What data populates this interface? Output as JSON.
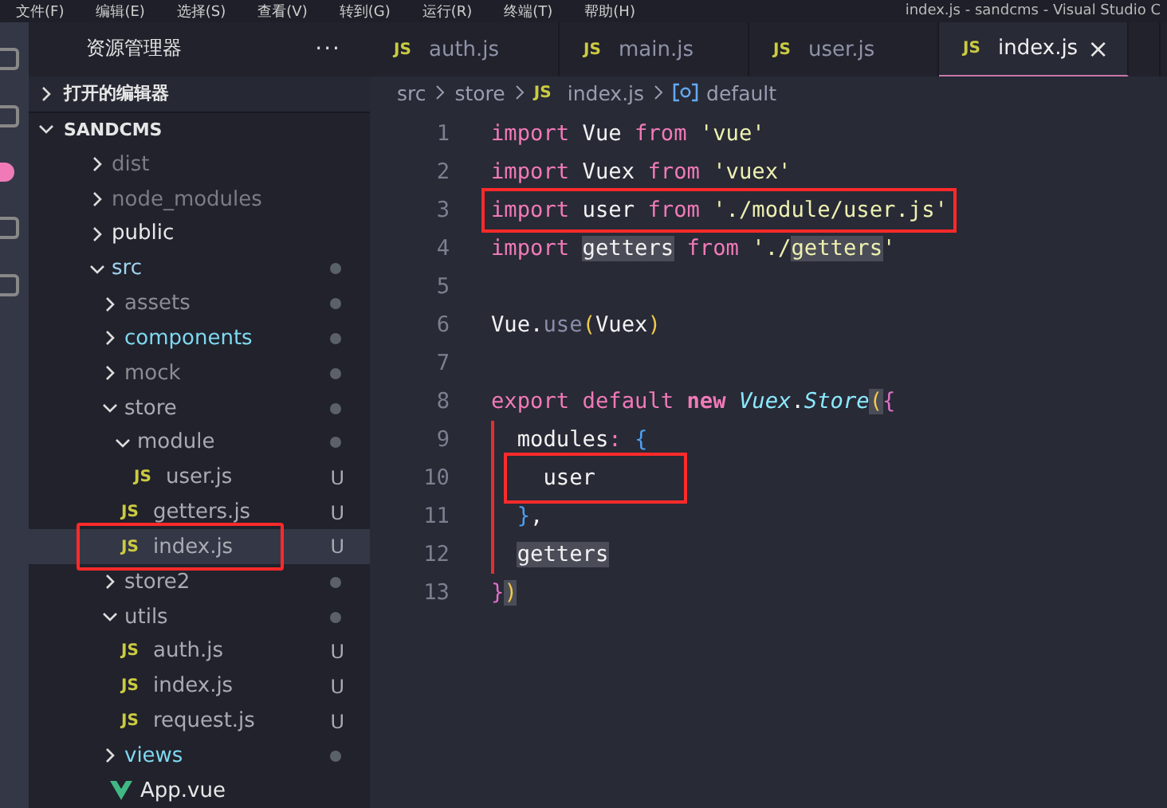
{
  "menu_bar": {
    "items": [
      "文件(F)",
      "编辑(E)",
      "选择(S)",
      "查看(V)",
      "转到(G)",
      "运行(R)",
      "终端(T)",
      "帮助(H)"
    ],
    "title": "index.js - sandcms - Visual Studio C"
  },
  "sidebar": {
    "title": "资源管理器",
    "more": "···",
    "sections": [
      {
        "label": "打开的编辑器",
        "expanded": false
      },
      {
        "label": "SANDCMS",
        "expanded": true
      }
    ],
    "tree": [
      {
        "name": "dist",
        "kind": "folder",
        "expanded": false,
        "color": "#7a7d85",
        "dot": false,
        "selected": false
      },
      {
        "name": "node_modules",
        "kind": "folder",
        "expanded": false,
        "color": "#7a7d85",
        "dot": false,
        "selected": false
      },
      {
        "name": "public",
        "kind": "folder",
        "expanded": false,
        "color": "#e8e8e8",
        "dot": false,
        "selected": false
      },
      {
        "name": "src",
        "kind": "folder",
        "expanded": true,
        "color": "#9fd3f0",
        "dot": true,
        "selected": false,
        "children": [
          {
            "name": "assets",
            "kind": "folder",
            "expanded": false,
            "color": "#8a8d94",
            "dot": true,
            "selected": false
          },
          {
            "name": "components",
            "kind": "folder",
            "expanded": false,
            "color": "#7fd8f0",
            "dot": true,
            "selected": false
          },
          {
            "name": "mock",
            "kind": "folder",
            "expanded": false,
            "color": "#8a8d94",
            "dot": true,
            "selected": false
          },
          {
            "name": "store",
            "kind": "folder",
            "expanded": true,
            "color": "#a9abb2",
            "dot": true,
            "selected": false,
            "children": [
              {
                "name": "module",
                "kind": "folder",
                "expanded": true,
                "color": "#a9abb2",
                "dot": true,
                "selected": false,
                "children": [
                  {
                    "name": "user.js",
                    "kind": "js",
                    "icon": "JS",
                    "badge": "U",
                    "color": "#a9abb2",
                    "selected": false
                  }
                ]
              },
              {
                "name": "getters.js",
                "kind": "js",
                "icon": "JS",
                "badge": "U",
                "color": "#a9abb2",
                "selected": false
              },
              {
                "name": "index.js",
                "kind": "js",
                "icon": "JS",
                "badge": "U",
                "color": "#a9abb2",
                "selected": true,
                "boxed": true
              }
            ]
          },
          {
            "name": "store2",
            "kind": "folder",
            "expanded": false,
            "color": "#a9abb2",
            "dot": true,
            "selected": false
          },
          {
            "name": "utils",
            "kind": "folder",
            "expanded": true,
            "color": "#a9abb2",
            "dot": true,
            "selected": false,
            "children": [
              {
                "name": "auth.js",
                "kind": "js",
                "icon": "JS",
                "badge": "U",
                "color": "#a9abb2",
                "selected": false
              },
              {
                "name": "index.js",
                "kind": "js",
                "icon": "JS",
                "badge": "U",
                "color": "#a9abb2",
                "selected": false
              },
              {
                "name": "request.js",
                "kind": "js",
                "icon": "JS",
                "badge": "U",
                "color": "#a9abb2",
                "selected": false
              }
            ]
          },
          {
            "name": "views",
            "kind": "folder",
            "expanded": false,
            "color": "#7fd8f0",
            "dot": true,
            "selected": false
          },
          {
            "name": "App.vue",
            "kind": "vue",
            "color": "#e8e8e8",
            "selected": false
          }
        ]
      }
    ]
  },
  "tabs": [
    {
      "icon": "JS",
      "label": "auth.js",
      "selected": false
    },
    {
      "icon": "JS",
      "label": "main.js",
      "selected": false
    },
    {
      "icon": "JS",
      "label": "user.js",
      "selected": false
    },
    {
      "icon": "JS",
      "label": "index.js",
      "selected": true,
      "close": "×"
    }
  ],
  "breadcrumb": [
    {
      "label": "src",
      "kind": "folder"
    },
    {
      "label": "store",
      "kind": "folder"
    },
    {
      "label": "index.js",
      "kind": "js",
      "icon": "JS"
    },
    {
      "label": "default",
      "kind": "symbol"
    }
  ],
  "code": [
    {
      "number": "1",
      "tokens": [
        {
          "text": "import",
          "kind": "keyword"
        },
        {
          "text": "Vue",
          "kind": "ident",
          "space": true
        },
        {
          "text": "from",
          "kind": "keyword",
          "space": true
        },
        {
          "text": "'vue'",
          "kind": "string",
          "space": true
        }
      ]
    },
    {
      "number": "2",
      "tokens": [
        {
          "text": "import",
          "kind": "keyword"
        },
        {
          "text": "Vuex",
          "kind": "ident",
          "space": true
        },
        {
          "text": "from",
          "kind": "keyword",
          "space": true
        },
        {
          "text": "'vuex'",
          "kind": "string",
          "space": true
        }
      ]
    },
    {
      "number": "3",
      "boxed": true,
      "tokens": [
        {
          "text": "import",
          "kind": "keyword"
        },
        {
          "text": "user",
          "kind": "ident",
          "space": true
        },
        {
          "text": "from",
          "kind": "keyword",
          "space": true
        },
        {
          "text": "'./module/user.js'",
          "kind": "string",
          "space": true
        }
      ]
    },
    {
      "number": "4",
      "tokens": [
        {
          "text": "import",
          "kind": "keyword"
        },
        {
          "text": "getters",
          "kind": "ident",
          "highlight": true,
          "space": true
        },
        {
          "text": "from",
          "kind": "keyword",
          "space": true
        },
        {
          "text": "'./",
          "kind": "string",
          "space": true
        },
        {
          "text": "getters",
          "kind": "string",
          "highlight": true
        },
        {
          "text": "'",
          "kind": "string"
        }
      ]
    },
    {
      "number": "5"
    },
    {
      "number": "6",
      "tokens": [
        {
          "text": "Vue.",
          "kind": "ident"
        },
        {
          "text": "use",
          "kind": "method"
        },
        {
          "text": "(",
          "kind": "paren"
        },
        {
          "text": "Vuex",
          "kind": "ident"
        },
        {
          "text": ")",
          "kind": "paren"
        }
      ]
    },
    {
      "number": "7"
    },
    {
      "number": "8",
      "tokens": [
        {
          "text": "export",
          "kind": "keyword"
        },
        {
          "text": "default",
          "kind": "keyword",
          "space": true
        },
        {
          "text": "new",
          "kind": "new",
          "space": true
        },
        {
          "text": "Vuex",
          "kind": "class",
          "space": true
        },
        {
          "text": ".",
          "kind": "ident"
        },
        {
          "text": "Store",
          "kind": "class"
        },
        {
          "text": "(",
          "kind": "paren",
          "highlight": true
        },
        {
          "text": "{",
          "kind": "brace"
        }
      ]
    },
    {
      "number": "9",
      "guide": true,
      "indented": true,
      "tokens": [
        {
          "text": "modules",
          "kind": "ident"
        },
        {
          "text": ":",
          "kind": "keyword"
        },
        {
          "text": "{",
          "kind": "brace2",
          "space": true
        }
      ]
    },
    {
      "number": "10",
      "guide": true,
      "indented": true,
      "boxed": true,
      "tokens": [
        {
          "text": "  user",
          "kind": "ident"
        }
      ]
    },
    {
      "number": "11",
      "guide": true,
      "indented": true,
      "tokens": [
        {
          "text": "}",
          "kind": "brace2"
        },
        {
          "text": ",",
          "kind": "ident"
        }
      ]
    },
    {
      "number": "12",
      "guide": true,
      "indented": true,
      "tokens": [
        {
          "text": "getters",
          "kind": "ident",
          "highlight": true
        }
      ]
    },
    {
      "number": "13",
      "tokens": [
        {
          "text": "}",
          "kind": "brace"
        },
        {
          "text": ")",
          "kind": "paren",
          "highlight": true
        }
      ]
    }
  ]
}
